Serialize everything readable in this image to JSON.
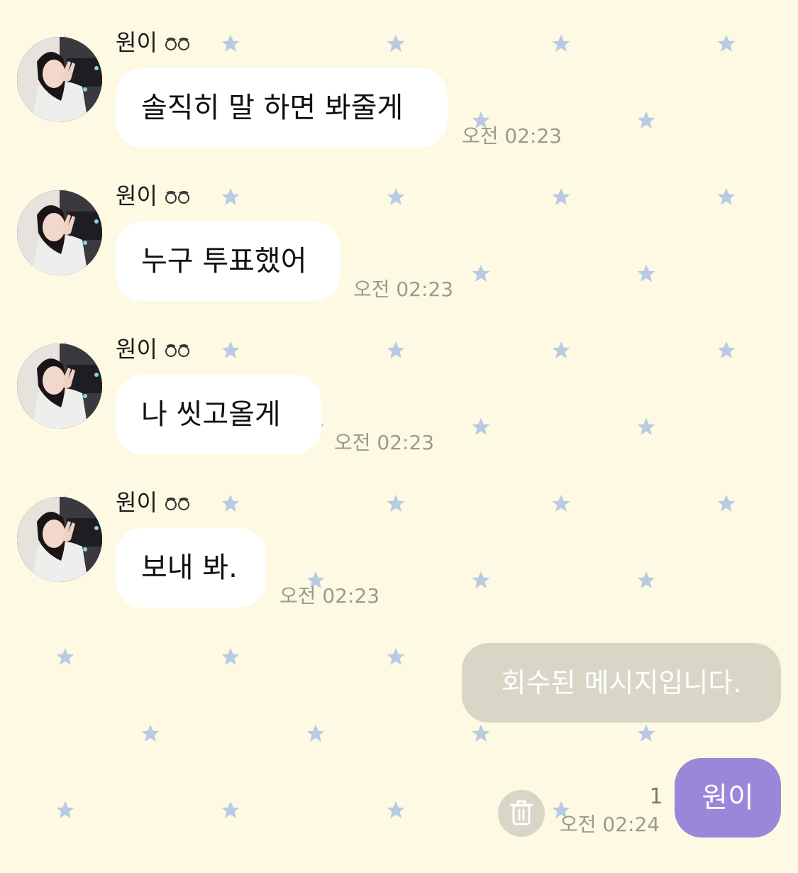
{
  "chat": {
    "background_color": "#fdf9e3",
    "star_color": "#b9cbe2",
    "messages": [
      {
        "sender": "원이",
        "sender_icon": "eyes-emoji-icon",
        "text": "솔직히 말 하면 봐줄게",
        "time": "오전 02:23"
      },
      {
        "sender": "원이",
        "sender_icon": "eyes-emoji-icon",
        "text": "누구 투표했어",
        "time": "오전 02:23"
      },
      {
        "sender": "원이",
        "sender_icon": "eyes-emoji-icon",
        "text": "나 씻고올게",
        "time": "오전 02:23"
      },
      {
        "sender": "원이",
        "sender_icon": "eyes-emoji-icon",
        "text": "보내 봐.",
        "time": "오전 02:23"
      }
    ],
    "recalled_message": "회수된 메시지입니다.",
    "my_message": {
      "text": "원이",
      "unread_count": "1",
      "time": "오전 02:24",
      "bubble_color": "#9b87d9"
    },
    "delete_icon": "trash-icon"
  }
}
